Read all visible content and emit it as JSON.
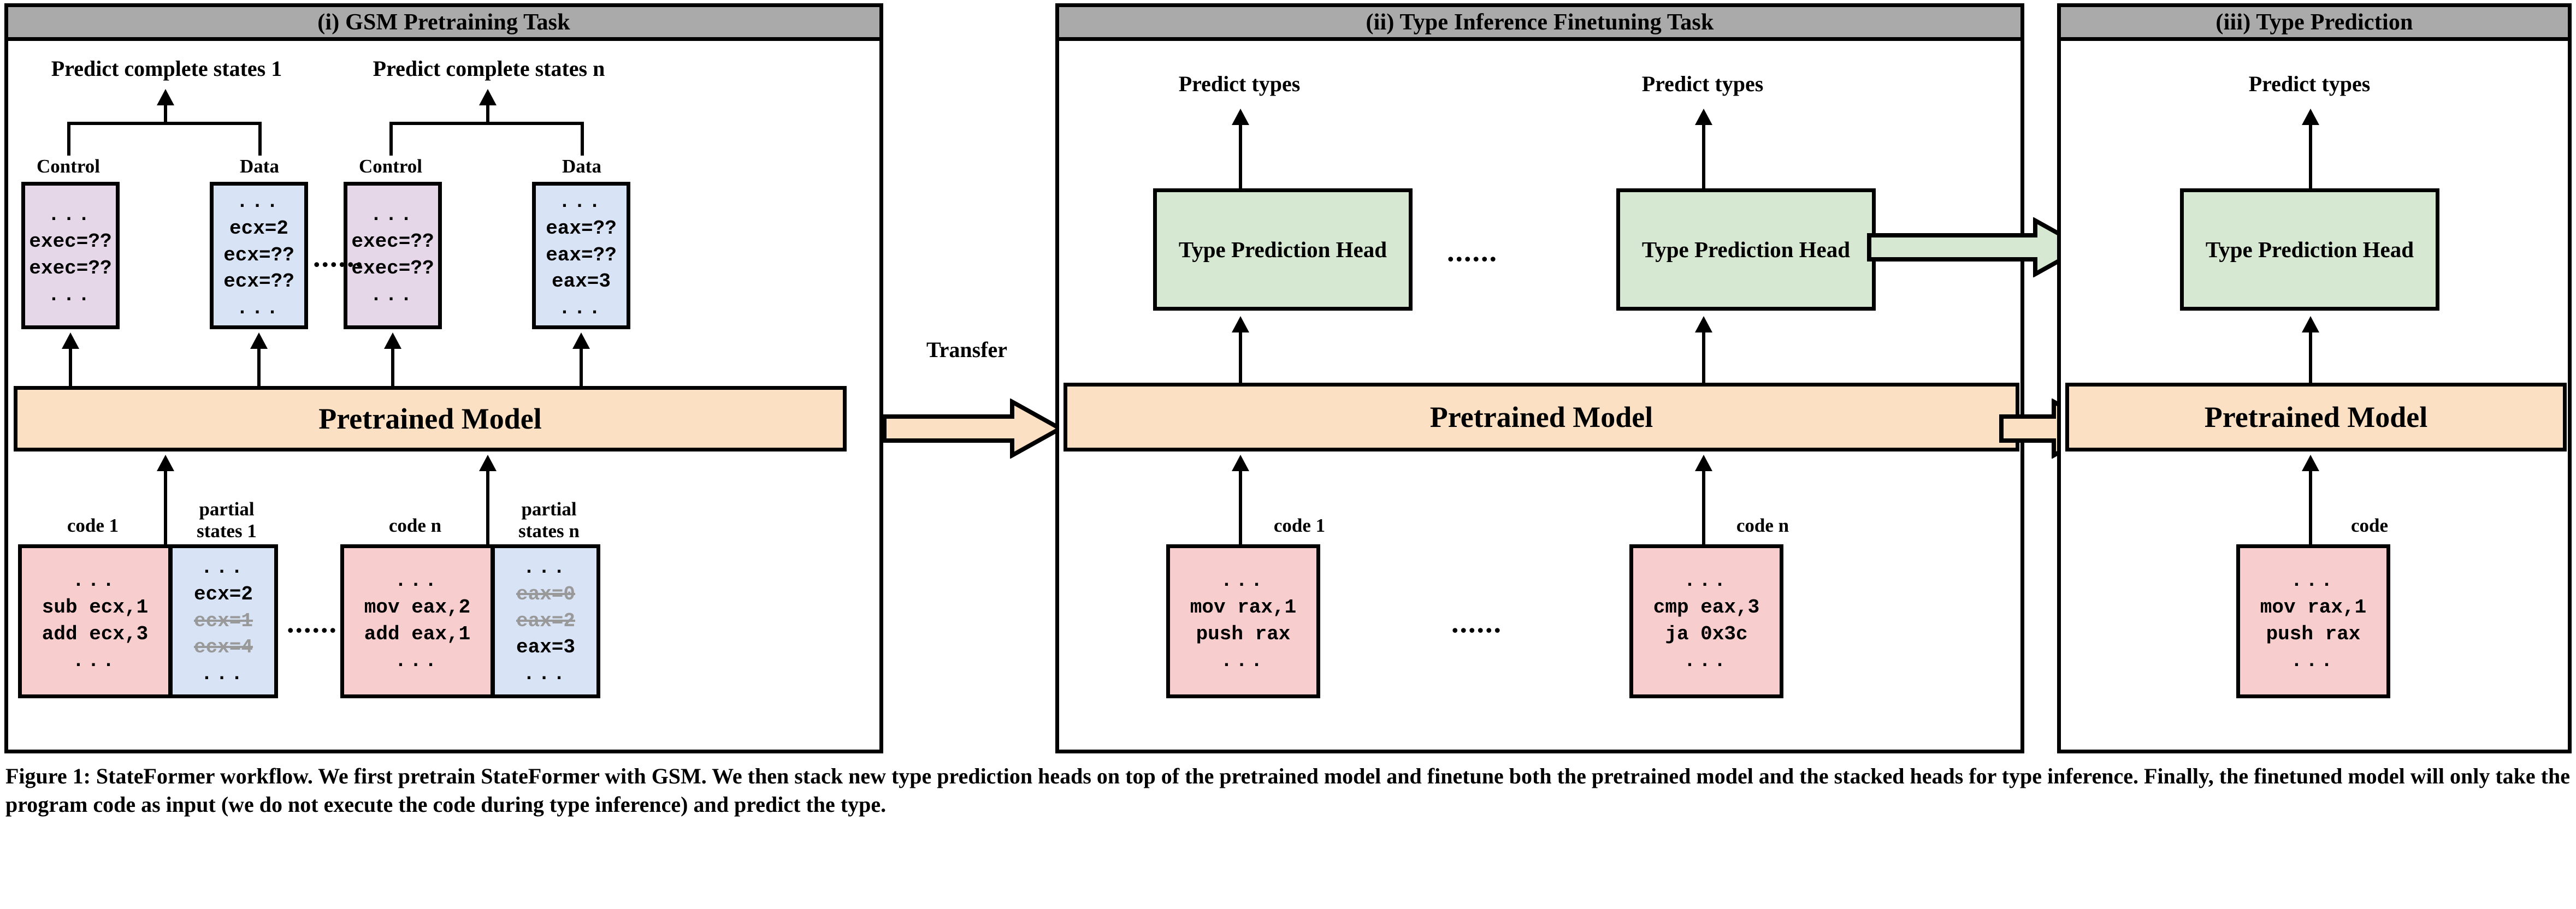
{
  "figure": {
    "caption": "Figure 1: StateFormer workflow. We first pretrain StateFormer with GSM. We then stack new type prediction heads on top of the pretrained model and finetune both the pretrained model and the stacked heads for type inference. Finally, the finetuned model will only take the program code as input (we do not execute the code during type inference) and predict the type.",
    "colors": {
      "header_gray": "#aaaaaa",
      "control_purple": "#e5d7e8",
      "data_blue": "#d8e4f5",
      "code_pink": "#f7cdcd",
      "model_orange": "#fce0c4",
      "head_green": "#d7e8d2",
      "ghost_gray": "#999999",
      "stroke_black": "#000000"
    },
    "ellipsis": "......",
    "dots": "..."
  },
  "panel_i": {
    "title": "(i) GSM Pretraining Task",
    "model_label": "Pretrained Model",
    "transfer_label": "Transfer",
    "groups": [
      {
        "predict_label": "Predict complete states 1",
        "control_label": "Control",
        "data_label": "Data",
        "control_lines": [
          "...",
          "exec=??",
          "exec=??",
          "..."
        ],
        "data_lines": [
          "...",
          "ecx=2",
          "ecx=??",
          "ecx=??",
          "..."
        ],
        "code_label": "code 1",
        "code_lines": [
          "...",
          "sub ecx,1",
          "add ecx,3",
          "..."
        ],
        "partial_label": "partial states 1",
        "partial_lines": [
          {
            "text": "...",
            "struck": false
          },
          {
            "text": "ecx=2",
            "struck": false
          },
          {
            "text": "ecx=1",
            "struck": true
          },
          {
            "text": "ecx=4",
            "struck": true
          },
          {
            "text": "...",
            "struck": false
          }
        ]
      },
      {
        "predict_label": "Predict complete states n",
        "control_label": "Control",
        "data_label": "Data",
        "control_lines": [
          "...",
          "exec=??",
          "exec=??",
          "..."
        ],
        "data_lines": [
          "...",
          "eax=??",
          "eax=??",
          "eax=3",
          "..."
        ],
        "code_label": "code n",
        "code_lines": [
          "...",
          "mov eax,2",
          "add eax,1",
          "..."
        ],
        "partial_label": "partial states n",
        "partial_lines": [
          {
            "text": "...",
            "struck": false
          },
          {
            "text": "eax=0",
            "struck": true
          },
          {
            "text": "eax=2",
            "struck": true
          },
          {
            "text": "eax=3",
            "struck": false
          },
          {
            "text": "...",
            "struck": false
          }
        ]
      }
    ]
  },
  "panel_ii": {
    "title": "(ii) Type Inference Finetuning Task",
    "model_label": "Pretrained Model",
    "groups": [
      {
        "predict_label": "Predict types",
        "head_label": "Type Prediction Head",
        "code_label": "code 1",
        "code_lines": [
          "...",
          "mov rax,1",
          "push rax",
          "..."
        ]
      },
      {
        "predict_label": "Predict types",
        "head_label": "Type Prediction Head",
        "code_label": "code n",
        "code_lines": [
          "...",
          "cmp eax,3",
          "ja 0x3c",
          "..."
        ]
      }
    ]
  },
  "panel_iii": {
    "title": "(iii) Type Prediction",
    "model_label": "Pretrained Model",
    "predict_label": "Predict types",
    "head_label": "Type Prediction Head",
    "code_label": "code",
    "code_lines": [
      "...",
      "mov rax,1",
      "push rax",
      "..."
    ]
  }
}
